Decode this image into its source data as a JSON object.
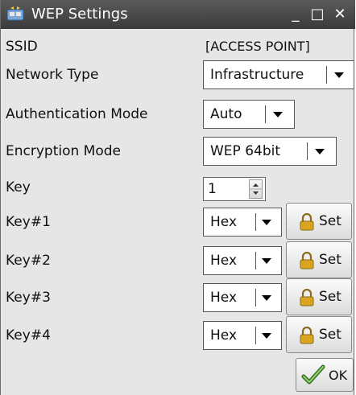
{
  "window": {
    "title": "WEP Settings",
    "icon": "network-card-icon",
    "controls": {
      "minimize": "_",
      "maximize": "□",
      "close": "✕"
    }
  },
  "fields": {
    "ssid": {
      "label": "SSID",
      "value": "[ACCESS POINT]"
    },
    "network_type": {
      "label": "Network Type",
      "value": "Infrastructure"
    },
    "auth_mode": {
      "label": "Authentication Mode",
      "value": "Auto"
    },
    "encryption_mode": {
      "label": "Encryption Mode",
      "value": "WEP 64bit"
    },
    "key": {
      "label": "Key",
      "value": "1"
    },
    "keys": [
      {
        "label": "Key#1",
        "format": "Hex",
        "button": "Set"
      },
      {
        "label": "Key#2",
        "format": "Hex",
        "button": "Set"
      },
      {
        "label": "Key#3",
        "format": "Hex",
        "button": "Set"
      },
      {
        "label": "Key#4",
        "format": "Hex",
        "button": "Set"
      }
    ]
  },
  "footer": {
    "ok_label": "OK"
  },
  "colors": {
    "titlebar": "#4a4a4a",
    "window_bg": "#e6e6e6",
    "lock_gold": "#d9a520"
  }
}
